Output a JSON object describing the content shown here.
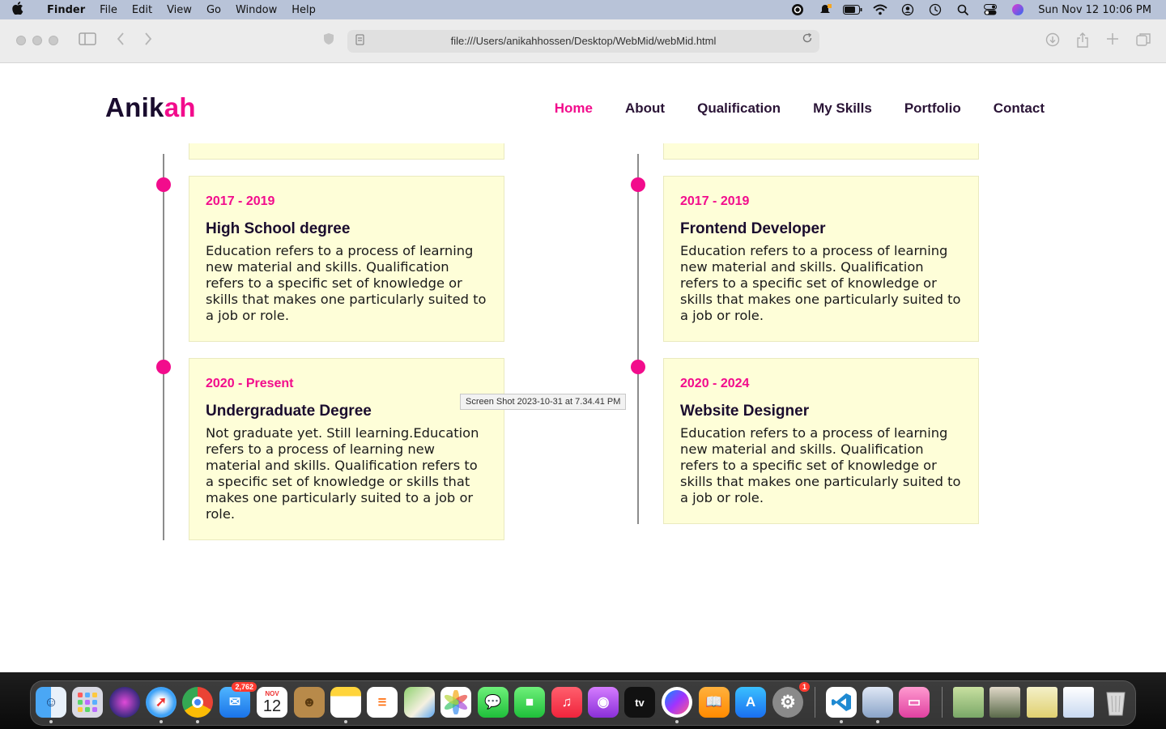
{
  "menubar": {
    "apple_icon": "",
    "app": "Finder",
    "menus": [
      "File",
      "Edit",
      "View",
      "Go",
      "Window",
      "Help"
    ],
    "clock": "Sun Nov 12  10:06 PM"
  },
  "browser": {
    "url": "file:///Users/anikahhossen/Desktop/WebMid/webMid.html"
  },
  "site": {
    "logo_part1": "Anik",
    "logo_part2": "ah",
    "nav": [
      "Home",
      "About",
      "Qualification",
      "My Skills",
      "Portfolio",
      "Contact"
    ],
    "active_nav": "Home",
    "accent_color": "#f20c8c",
    "card_bg": "#fefed8"
  },
  "timeline": {
    "education": [
      {
        "date": "2017 - 2019",
        "title": "High School degree",
        "desc": "Education refers to a process of learning new material and skills. Qualification refers to a specific set of knowledge or skills that makes one particularly suited to a job or role."
      },
      {
        "date": "2020 - Present",
        "title": "Undergraduate Degree",
        "desc": "Not graduate yet. Still learning.Education refers to a process of learning new material and skills. Qualification refers to a specific set of knowledge or skills that makes one particularly suited to a job or role."
      }
    ],
    "experience": [
      {
        "date": "2017 - 2019",
        "title": "Frontend Developer",
        "desc": "Education refers to a process of learning new material and skills. Qualification refers to a specific set of knowledge or skills that makes one particularly suited to a job or role."
      },
      {
        "date": "2020 - 2024",
        "title": "Website Designer",
        "desc": "Education refers to a process of learning new material and skills. Qualification refers to a specific set of knowledge or skills that makes one particularly suited to a job or role."
      }
    ]
  },
  "tooltip": "Screen Shot 2023-10-31 at 7.34.41 PM",
  "dock": {
    "mail_badge": "2,762",
    "calendar_month": "NOV",
    "calendar_day": "12",
    "settings_badge": "1",
    "icons": [
      "finder-icon",
      "launchpad-icon",
      "siri-icon",
      "safari-icon",
      "chrome-icon",
      "mail-icon",
      "calendar-icon",
      "contacts-icon",
      "notes-icon",
      "reminders-icon",
      "maps-icon",
      "photos-icon",
      "messages-icon",
      "facetime-icon",
      "music-icon",
      "podcasts-icon",
      "tv-icon",
      "messenger-icon",
      "books-icon",
      "app-store-icon",
      "system-settings-icon",
      "vscode-icon",
      "preview-icon",
      "cleanmymac-icon",
      "image-thumbnail-icon",
      "photo-thumbnail-icon",
      "screenshot-thumbnail-icon",
      "document-thumbnail-icon",
      "trash-icon"
    ]
  }
}
